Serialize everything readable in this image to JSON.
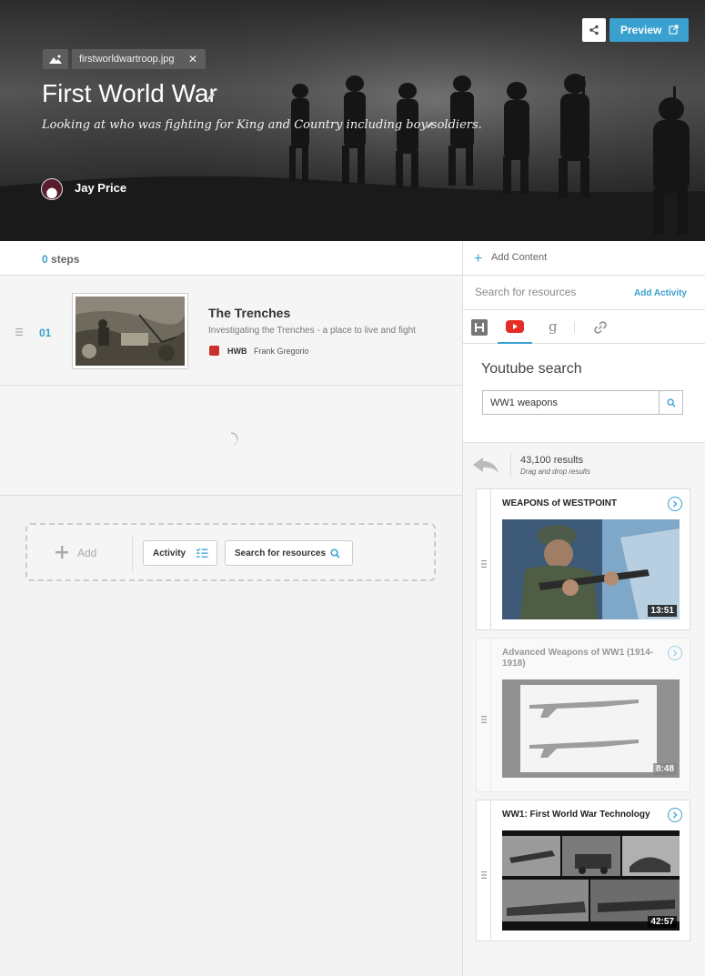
{
  "header": {
    "image_file": "firstworldwartroop.jpg",
    "title": "First World War",
    "subtitle": "Looking at who was fighting for King and Country including boy soldiers.",
    "author": "Jay Price",
    "preview_label": "Preview"
  },
  "steps": {
    "count": "0",
    "count_label": "steps",
    "items": [
      {
        "number": "01",
        "title": "The Trenches",
        "description": "Investigating the Trenches - a place to live and fight",
        "source": "HWB",
        "author": "Frank Gregorio"
      }
    ]
  },
  "add_bar": {
    "add_label": "Add",
    "activity_label": "Activity",
    "search_label": "Search for resources"
  },
  "sidebar": {
    "add_content_label": "Add Content",
    "search_resources_label": "Search for resources",
    "add_activity_label": "Add Activity",
    "tabs": [
      {
        "icon": "hwb-icon"
      },
      {
        "icon": "youtube-icon",
        "active": true
      },
      {
        "icon": "google-icon"
      },
      {
        "icon": "link-icon"
      }
    ],
    "youtube_title": "Youtube search",
    "search_value": "WW1 weapons",
    "results_count": "43,100 results",
    "results_hint": "Drag and drop results",
    "results": [
      {
        "title": "WEAPONS of WESTPOINT",
        "duration": "13:51"
      },
      {
        "title": "Advanced Weapons of WW1 (1914-1918)",
        "duration": "8:48"
      },
      {
        "title": "WW1: First World War Technology",
        "duration": "42:57"
      }
    ]
  },
  "colors": {
    "accent": "#3aa0cf",
    "youtube": "#e52d27",
    "hwb": "#c9302c"
  }
}
